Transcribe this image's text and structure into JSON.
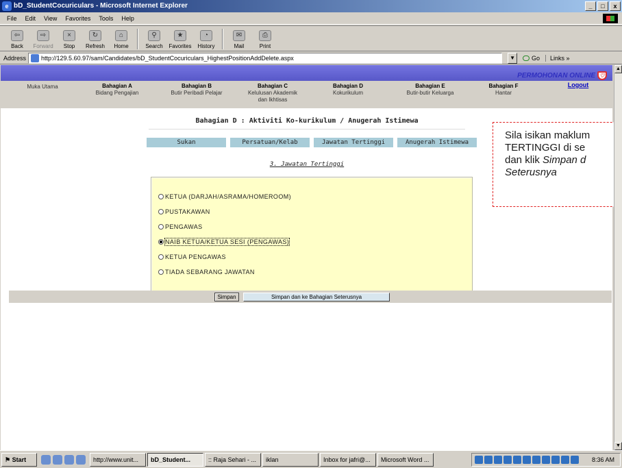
{
  "window": {
    "title": "bD_StudentCocuriculars - Microsoft Internet Explorer",
    "controls": [
      "_",
      "□",
      "x"
    ]
  },
  "menu": [
    "File",
    "Edit",
    "View",
    "Favorites",
    "Tools",
    "Help"
  ],
  "toolbar": {
    "back": "Back",
    "forward": "Forward",
    "stop": "Stop",
    "refresh": "Refresh",
    "home": "Home",
    "search": "Search",
    "favorites": "Favorites",
    "history": "History",
    "mail": "Mail",
    "print": "Print"
  },
  "address": {
    "label": "Address",
    "url": "http://129.5.60.97/sam/Candidates/bD_StudentCocuriculars_HighestPositionAddDelete.aspx",
    "go": "Go",
    "links": "Links »"
  },
  "brand": "PERMOHONAN ONLINE",
  "nav": {
    "home": "Muka Utama",
    "a_title": "Bahagian A",
    "a_sub": "Bidang Pengajian",
    "b_title": "Bahagian B",
    "b_sub": "Butir Peribadi Pelajar",
    "c_title": "Bahagian C",
    "c_sub1": "Kelulusan Akademik",
    "c_sub2": "dan Ikhtisas",
    "d_title": "Bahagian D",
    "d_sub": "Kokurikulum",
    "e_title": "Bahagian E",
    "e_sub": "Butir-butir Keluarga",
    "f_title": "Bahagian F",
    "f_sub": "Hantar",
    "logout": "Logout"
  },
  "page": {
    "section_title": "Bahagian D : Aktiviti Ko-kurikulum / Anugerah Istimewa",
    "tabs": [
      "Sukan",
      "Persatuan/Kelab",
      "Jawatan Tertinggi",
      "Anugerah Istimewa"
    ],
    "sub_heading": "3. Jawatan Tertinggi",
    "options": [
      "KETUA (DARJAH/ASRAMA/HOMEROOM)",
      "PUSTAKAWAN",
      "PENGAWAS",
      "NAIB KETUA/KETUA SESI (PENGAWAS)",
      "KETUA PENGAWAS",
      "TIADA SEBARANG JAWATAN"
    ],
    "selected_option": "NAIB KETUA/KETUA SESI (PENGAWAS)",
    "buttons": {
      "save": "Simpan",
      "save_next": "Simpan dan ke Bahagian Seterusnya"
    }
  },
  "callout": {
    "line1": "Sila isikan maklum",
    "line2": "TERTINGGI di se",
    "line3_plain": "dan klik ",
    "line3_em": "Simpan d",
    "line4_em": "Seterusnya"
  },
  "taskbar": {
    "start": "Start",
    "tasks": [
      "http://www.unit...",
      "bD_Student...",
      ":: Raja Sehari - ...",
      "iklan",
      "Inbox for jafri@...",
      "Microsoft Word ..."
    ],
    "clock": "8:36 AM"
  },
  "colors": {
    "banner": "#6868d8",
    "panel": "#ffffc8",
    "tab": "#a8ccd8",
    "callout_border": "#e02020"
  }
}
